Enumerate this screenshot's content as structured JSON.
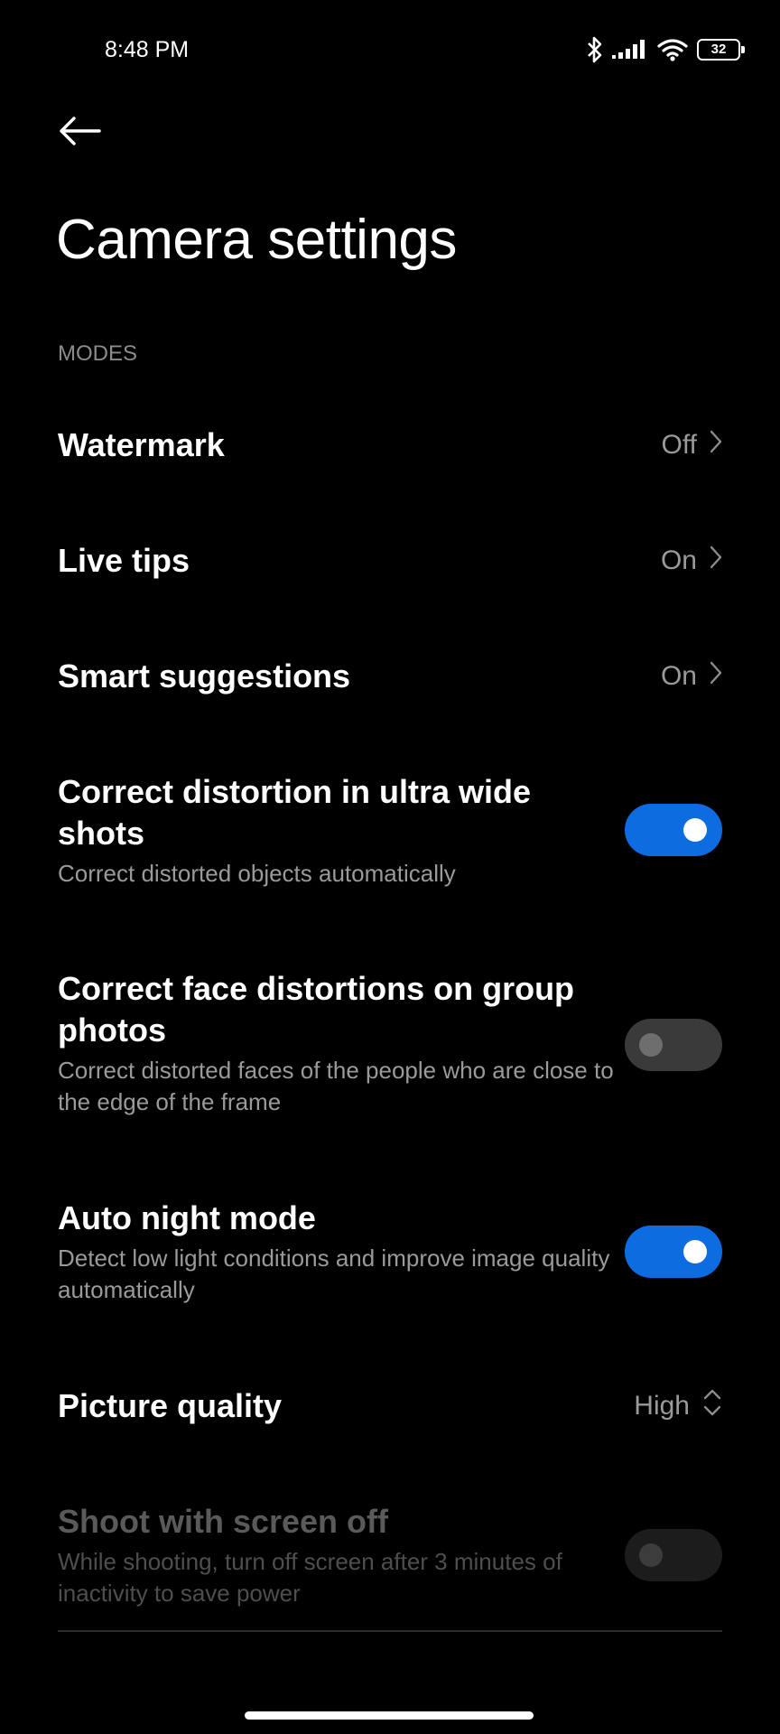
{
  "status_bar": {
    "time": "8:48 PM",
    "battery_level": "32",
    "icons": [
      "bluetooth-icon",
      "cellular-signal-icon",
      "wifi-icon",
      "battery-icon"
    ]
  },
  "header": {
    "back_icon": "arrow-left-icon",
    "title": "Camera settings"
  },
  "section": {
    "label": "MODES"
  },
  "settings": {
    "watermark": {
      "title": "Watermark",
      "value": "Off"
    },
    "live_tips": {
      "title": "Live tips",
      "value": "On"
    },
    "smart_suggestions": {
      "title": "Smart suggestions",
      "value": "On"
    },
    "ultra_wide_distortion": {
      "title": "Correct distortion in ultra wide shots",
      "description": "Correct distorted objects automatically",
      "enabled": true
    },
    "face_distortion": {
      "title": "Correct face distortions on group photos",
      "description": "Correct distorted faces of the people who are close to the edge of the frame",
      "enabled": false
    },
    "auto_night_mode": {
      "title": "Auto night mode",
      "description": "Detect low light conditions and improve image quality automatically",
      "enabled": true
    },
    "picture_quality": {
      "title": "Picture quality",
      "value": "High"
    },
    "shoot_screen_off": {
      "title": "Shoot with screen off",
      "description": "While shooting, turn off screen after 3 minutes of inactivity to save power",
      "enabled": false,
      "disabled": true
    }
  },
  "colors": {
    "background": "#000000",
    "toggle_on": "#0c6ce0",
    "toggle_off": "#3a3a3a",
    "secondary_text": "#9a9a9a"
  }
}
